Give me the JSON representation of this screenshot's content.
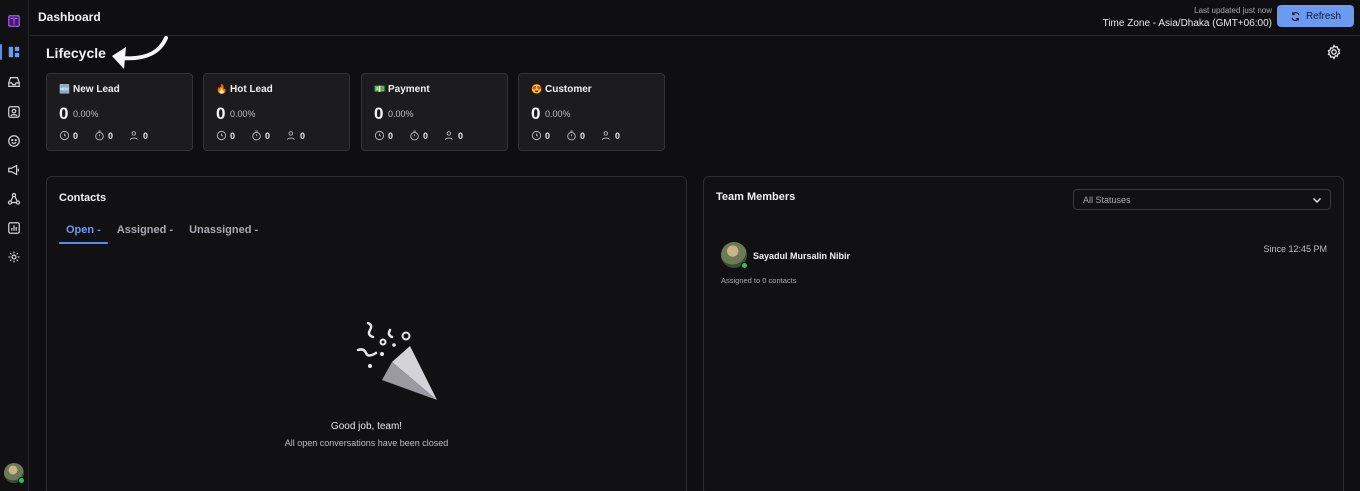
{
  "topbar": {
    "title": "Dashboard",
    "last_updated": "Last updated just now",
    "timezone": "Time Zone - Asia/Dhaka (GMT+06:00)",
    "refresh_label": "Refresh"
  },
  "sidebar": {
    "items": [
      {
        "icon": "book-logo-icon"
      },
      {
        "icon": "dashboard-icon",
        "active": true
      },
      {
        "icon": "inbox-icon"
      },
      {
        "icon": "contacts-icon"
      },
      {
        "icon": "smiley-icon"
      },
      {
        "icon": "megaphone-icon"
      },
      {
        "icon": "workflow-icon"
      },
      {
        "icon": "reports-icon"
      },
      {
        "icon": "settings-icon"
      }
    ]
  },
  "lifecycle": {
    "title": "Lifecycle",
    "cards": [
      {
        "emoji": "🆕",
        "label": "New Lead",
        "count": "0",
        "percent": "0.00%",
        "stats": [
          "0",
          "0",
          "0"
        ]
      },
      {
        "emoji": "🔥",
        "label": "Hot Lead",
        "count": "0",
        "percent": "0.00%",
        "stats": [
          "0",
          "0",
          "0"
        ]
      },
      {
        "emoji": "💵",
        "label": "Payment",
        "count": "0",
        "percent": "0.00%",
        "stats": [
          "0",
          "0",
          "0"
        ]
      },
      {
        "emoji": "😍",
        "label": "Customer",
        "count": "0",
        "percent": "0.00%",
        "stats": [
          "0",
          "0",
          "0"
        ]
      }
    ]
  },
  "contacts": {
    "title": "Contacts",
    "tabs": [
      {
        "label": "Open  -",
        "active": true
      },
      {
        "label": "Assigned  -",
        "active": false
      },
      {
        "label": "Unassigned  -",
        "active": false
      }
    ],
    "empty_title": "Good job, team!",
    "empty_subtitle": "All open conversations have been closed"
  },
  "team": {
    "title": "Team Members",
    "status_filter": "All Statuses",
    "members": [
      {
        "name": "Sayadul Mursalin Nibir",
        "since": "Since 12:45 PM",
        "assigned": "Assigned to 0 contacts"
      }
    ]
  },
  "colors": {
    "accent": "#6b9af0",
    "background": "#0f0f11",
    "card": "#1c1c1f",
    "online": "#22c55e"
  }
}
